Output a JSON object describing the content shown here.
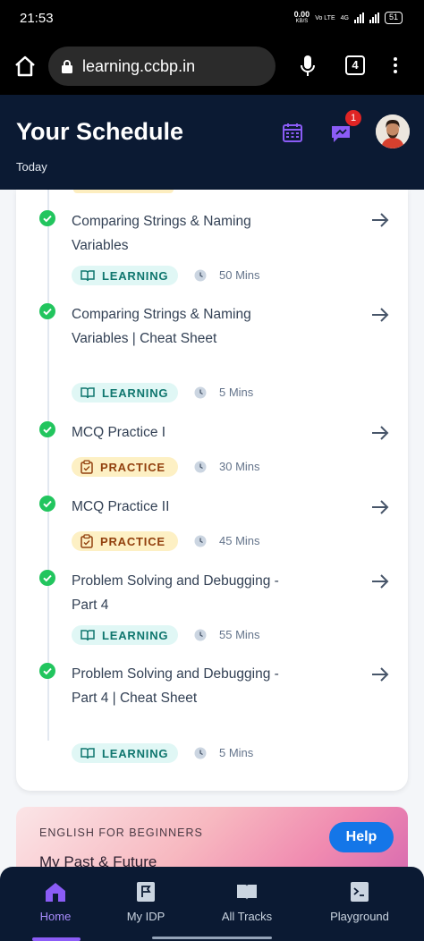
{
  "status_bar": {
    "time": "21:53",
    "net_speed_value": "0.00",
    "net_speed_unit": "KB/S",
    "network_a": "Vo LTE",
    "network_b": "4G",
    "battery": "51"
  },
  "browser": {
    "url": "learning.ccbp.in",
    "tab_count": "4"
  },
  "header": {
    "title": "Your Schedule",
    "subtitle": "Today",
    "notification_count": "1"
  },
  "schedule": {
    "items": [
      {
        "title": "Comparing Strings & Naming Variables",
        "tag": "LEARNING",
        "duration": "50 Mins"
      },
      {
        "title": "Comparing Strings & Naming Variables | Cheat Sheet",
        "tag": "LEARNING",
        "duration": "5 Mins"
      },
      {
        "title": "MCQ Practice I",
        "tag": "PRACTICE",
        "duration": "30 Mins"
      },
      {
        "title": "MCQ Practice II",
        "tag": "PRACTICE",
        "duration": "45 Mins"
      },
      {
        "title": "Problem Solving and Debugging - Part 4",
        "tag": "LEARNING",
        "duration": "55 Mins"
      },
      {
        "title": "Problem Solving and Debugging - Part 4 | Cheat Sheet",
        "tag": "LEARNING",
        "duration": "5 Mins"
      }
    ]
  },
  "promo": {
    "label": "ENGLISH FOR BEGINNERS",
    "title": "My Past & Future",
    "help_label": "Help"
  },
  "bottom_nav": {
    "items": [
      {
        "label": "Home",
        "icon": "home-icon",
        "active": true
      },
      {
        "label": "My IDP",
        "icon": "flag-icon",
        "active": false
      },
      {
        "label": "All Tracks",
        "icon": "book-icon",
        "active": false
      },
      {
        "label": "Playground",
        "icon": "terminal-icon",
        "active": false
      }
    ]
  },
  "colors": {
    "header_bg": "#0b1a33",
    "accent_purple": "#8b5cf6",
    "check_green": "#22c55e",
    "learning_tag_bg": "#e0f7f5",
    "practice_tag_bg": "#fdf0c4",
    "help_blue": "#1476e8"
  }
}
